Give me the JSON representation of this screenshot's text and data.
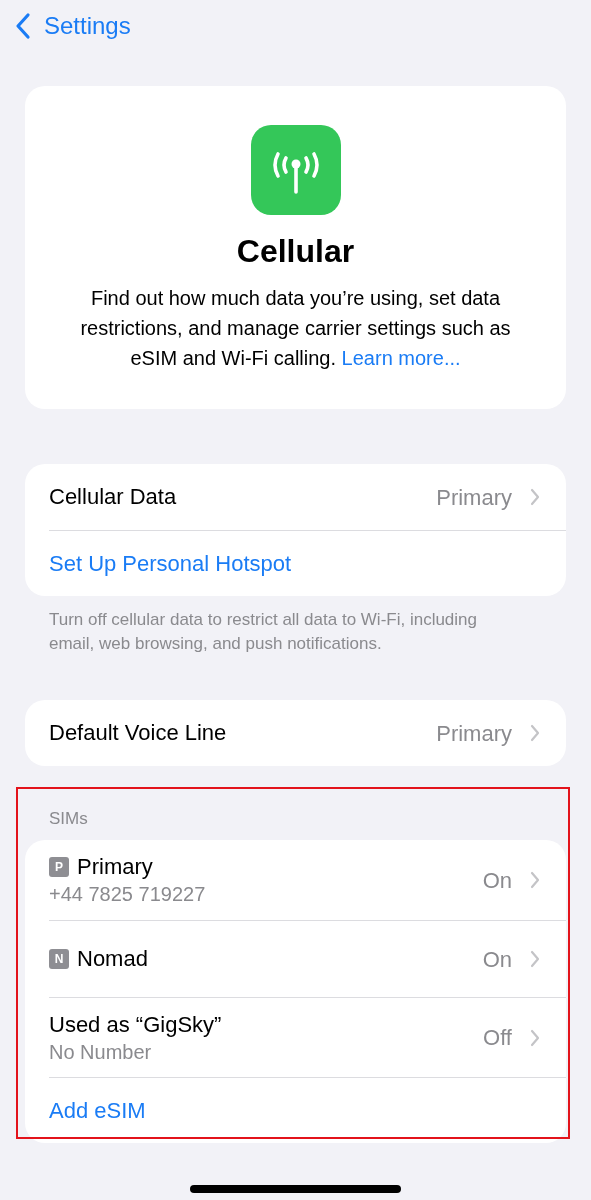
{
  "nav": {
    "back_label": "Settings"
  },
  "header": {
    "title": "Cellular",
    "description": "Find out how much data you’re using, set data restrictions, and manage carrier settings such as eSIM and Wi-Fi calling.",
    "link": "Learn more..."
  },
  "groups": [
    {
      "rows": [
        {
          "kind": "nav",
          "label": "Cellular Data",
          "value": "Primary"
        },
        {
          "kind": "link",
          "label": "Set Up Personal Hotspot"
        }
      ],
      "footer": "Turn off cellular data to restrict all data to Wi-Fi, including email, web browsing, and push notifications."
    },
    {
      "rows": [
        {
          "kind": "nav",
          "label": "Default Voice Line",
          "value": "Primary"
        }
      ]
    },
    {
      "highlighted": true,
      "header": "SIMs",
      "rows": [
        {
          "kind": "sim",
          "badge": "P",
          "label": "Primary",
          "subtitle": "+44 7825 719227",
          "value": "On"
        },
        {
          "kind": "sim",
          "badge": "N",
          "label": "Nomad",
          "value": "On"
        },
        {
          "kind": "sim",
          "label": "Used as “GigSky”",
          "subtitle": "No Number",
          "value": "Off"
        },
        {
          "kind": "link",
          "label": "Add eSIM"
        }
      ]
    }
  ]
}
